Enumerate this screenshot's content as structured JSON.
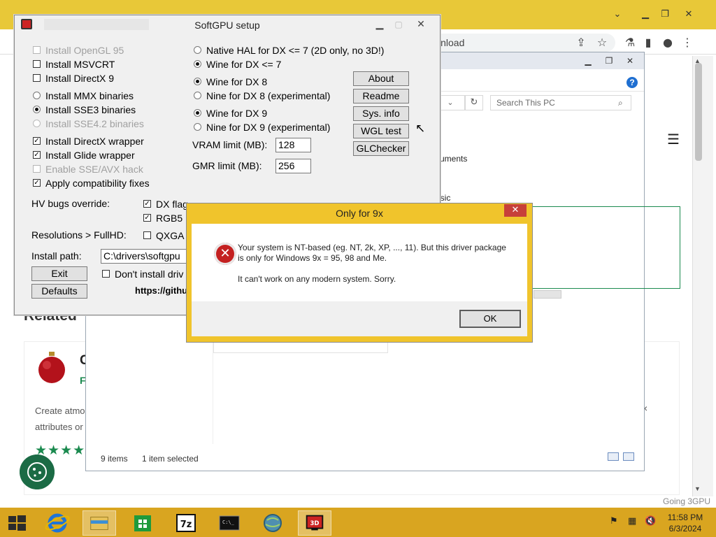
{
  "browser": {
    "omnibox_text": "wnload",
    "related_heading": "Related",
    "card": {
      "title": "C",
      "subtitle": "F",
      "desc_line1": "Create atmo",
      "desc_line2": "attributes or",
      "stars": "★★★★",
      "close_glyph": "×"
    },
    "watermark": "Going 3GPU"
  },
  "explorer": {
    "search_placeholder": "Search This PC",
    "list_items": [
      "cuments",
      "usic"
    ],
    "status_items": "9 items",
    "status_selected": "1 item selected",
    "help_glyph": "?"
  },
  "softgpu": {
    "title": "SoftGPU setup",
    "left_options": [
      {
        "label": "Install OpenGL 95",
        "type": "checkbox",
        "checked": false,
        "disabled": true
      },
      {
        "label": "Install MSVCRT",
        "type": "checkbox",
        "checked": false,
        "disabled": false
      },
      {
        "label": "Install DirectX 9",
        "type": "checkbox",
        "checked": false,
        "disabled": false
      },
      {
        "label": "Install MMX binaries",
        "type": "radio",
        "checked": false,
        "disabled": false
      },
      {
        "label": "Install SSE3 binaries",
        "type": "radio",
        "checked": true,
        "disabled": false
      },
      {
        "label": "Install SSE4.2 binaries",
        "type": "radio",
        "checked": false,
        "disabled": true
      },
      {
        "label": "Install DirectX wrapper",
        "type": "checkbox",
        "checked": true,
        "disabled": false
      },
      {
        "label": "Install Glide wrapper",
        "type": "checkbox",
        "checked": true,
        "disabled": false
      },
      {
        "label": "Enable SSE/AVX hack",
        "type": "checkbox",
        "checked": false,
        "disabled": true
      },
      {
        "label": "Apply compatibility fixes",
        "type": "checkbox",
        "checked": true,
        "disabled": false
      }
    ],
    "middle_options": [
      {
        "label": "Native HAL for DX <= 7 (2D only, no 3D!)",
        "checked": false
      },
      {
        "label": "Wine for DX <= 7",
        "checked": true
      },
      {
        "label": "Wine for DX 8",
        "checked": true
      },
      {
        "label": "Nine for DX 8 (experimental)",
        "checked": false
      },
      {
        "label": "Wine for DX 9",
        "checked": true
      },
      {
        "label": "Nine for DX 9 (experimental)",
        "checked": false
      }
    ],
    "vram_label": "VRAM limit (MB):",
    "vram_value": "128",
    "gmr_label": "GMR limit (MB):",
    "gmr_value": "256",
    "buttons": {
      "about": "About",
      "readme": "Readme",
      "sysinfo": "Sys. info",
      "wgl": "WGL test",
      "glchecker": "GLChecker",
      "exit": "Exit",
      "defaults": "Defaults"
    },
    "hv_label": "HV bugs override:",
    "hv_dx_flags": "DX flag",
    "hv_rgb": "RGB5",
    "res_label": "Resolutions > FullHD:",
    "res_qxga": "QXGA",
    "install_path_label": "Install path:",
    "install_path_value": "C:\\drivers\\softgpu",
    "dont_install": "Don't install driv",
    "url": "https://githu"
  },
  "dialog": {
    "title": "Only for 9x",
    "message_line1": "Your system is NT-based (eg. NT, 2k, XP, ..., 11). But this driver package",
    "message_line2": "is only for Windows 9x = 95, 98 and Me.",
    "message2": "It can't work on any modern system. Sorry.",
    "ok": "OK",
    "close_glyph": "✕",
    "error_glyph": "✕"
  },
  "taskbar": {
    "time": "11:58 PM",
    "date": "6/3/2024"
  }
}
